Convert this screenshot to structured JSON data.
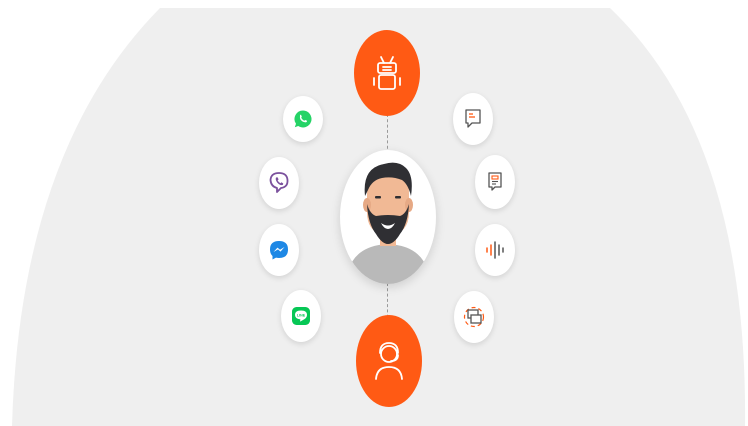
{
  "scene": {
    "colors": {
      "accent": "#ff5a14",
      "background_shape": "#efefef",
      "card": "#ffffff",
      "whatsapp": "#25d366",
      "viber": "#7b519d",
      "messenger": "#1e88e5",
      "line": "#06c755"
    },
    "center": {
      "icon": "user-avatar"
    },
    "top_node": {
      "icon": "robot-icon"
    },
    "bottom_node": {
      "icon": "headset-agent-icon"
    },
    "left_channels": [
      {
        "icon": "whatsapp-icon"
      },
      {
        "icon": "viber-icon"
      },
      {
        "icon": "messenger-icon"
      },
      {
        "icon": "line-icon"
      }
    ],
    "right_channels": [
      {
        "icon": "chat-message-icon"
      },
      {
        "icon": "document-icon"
      },
      {
        "icon": "voice-waveform-icon"
      },
      {
        "icon": "screen-share-icon"
      }
    ]
  }
}
